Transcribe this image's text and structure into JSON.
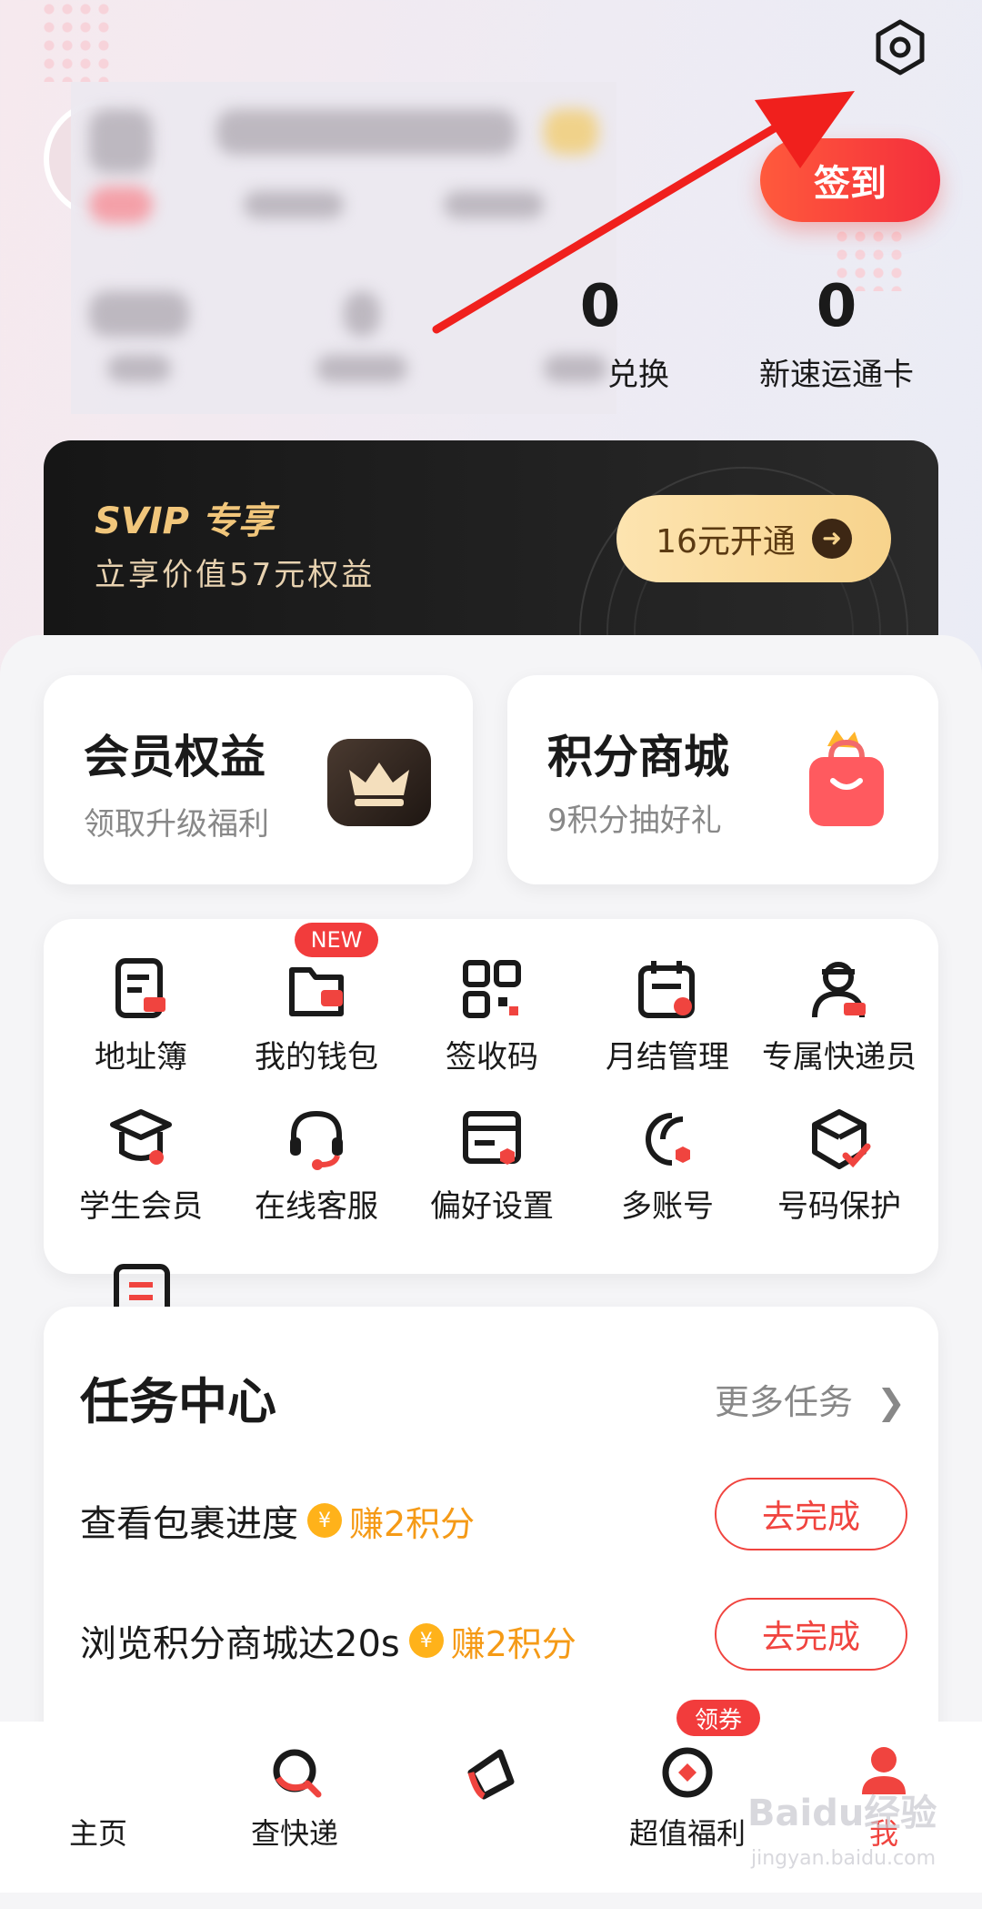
{
  "header": {
    "signin_label": "签到",
    "stats": [
      {
        "value": "0",
        "label": "兑换"
      },
      {
        "value": "0",
        "label": "新速运通卡"
      }
    ]
  },
  "svip": {
    "title": "SVIP 专享",
    "subtitle": "立享价值57元权益",
    "button_label": "16元开通"
  },
  "promo_cards": [
    {
      "title": "会员权益",
      "subtitle": "领取升级福利",
      "icon": "crown-icon"
    },
    {
      "title": "积分商城",
      "subtitle": "9积分抽好礼",
      "icon": "shopping-bag-icon"
    }
  ],
  "services": {
    "new_badge": "NEW",
    "items": [
      {
        "label": "地址簿",
        "icon": "address-book-icon"
      },
      {
        "label": "我的钱包",
        "icon": "wallet-icon"
      },
      {
        "label": "签收码",
        "icon": "qr-code-icon"
      },
      {
        "label": "月结管理",
        "icon": "calendar-icon"
      },
      {
        "label": "专属快递员",
        "icon": "courier-icon"
      },
      {
        "label": "学生会员",
        "icon": "graduation-cap-icon"
      },
      {
        "label": "在线客服",
        "icon": "headset-icon"
      },
      {
        "label": "偏好设置",
        "icon": "preferences-icon"
      },
      {
        "label": "多账号",
        "icon": "multi-account-icon"
      },
      {
        "label": "号码保护",
        "icon": "shield-check-icon"
      }
    ]
  },
  "tasks": {
    "title": "任务中心",
    "more_label": "更多任务",
    "items": [
      {
        "text": "查看包裹进度",
        "reward": "赚2积分",
        "button": "去完成"
      },
      {
        "text": "浏览积分商城达20s",
        "reward": "赚2积分",
        "button": "去完成"
      }
    ]
  },
  "bottom_nav": {
    "coupon_badge": "领券",
    "items": [
      {
        "label": "主页"
      },
      {
        "label": "查快递"
      },
      {
        "label": ""
      },
      {
        "label": "超值福利"
      },
      {
        "label": "我"
      }
    ]
  },
  "watermark": {
    "main": "Baidu经验",
    "sub": "jingyan.baidu.com"
  },
  "colors": {
    "accent": "#f0443f",
    "gold": "#f1c67b",
    "reward": "#f59a16"
  }
}
